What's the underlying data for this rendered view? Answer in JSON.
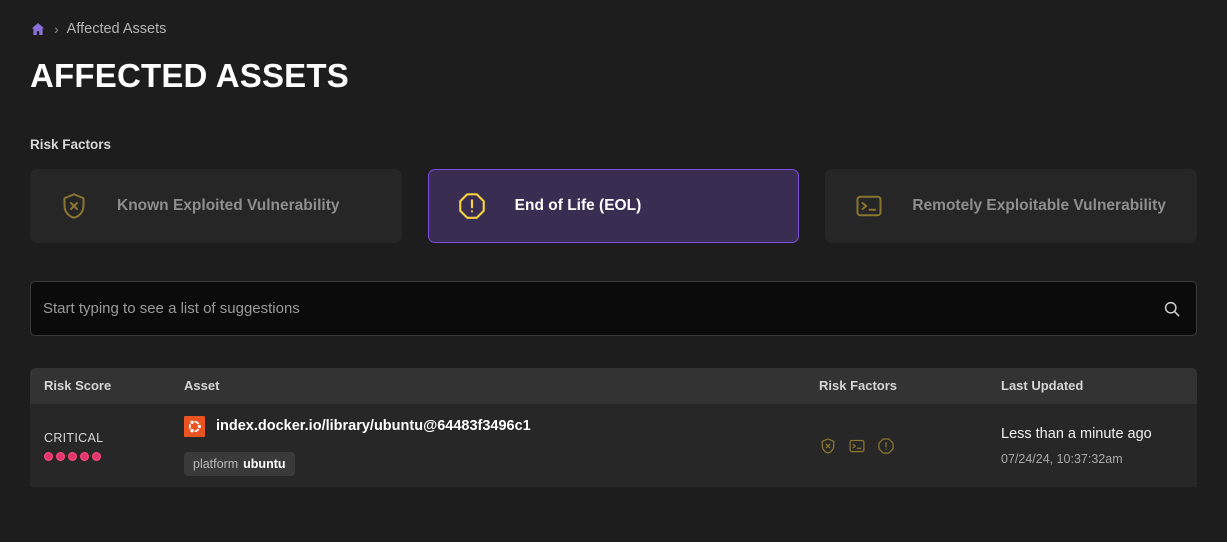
{
  "breadcrumb": {
    "home_icon": "home-icon",
    "separator": "›",
    "current": "Affected Assets"
  },
  "page_title": "AFFECTED ASSETS",
  "risk_factors_section": {
    "label": "Risk Factors",
    "cards": [
      {
        "label": "Known Exploited Vulnerability",
        "icon": "shield-x-icon",
        "selected": false
      },
      {
        "label": "End of Life (EOL)",
        "icon": "octagon-alert-icon",
        "selected": true
      },
      {
        "label": "Remotely Exploitable Vulnerability",
        "icon": "terminal-icon",
        "selected": false
      }
    ]
  },
  "search": {
    "placeholder": "Start typing to see a list of suggestions",
    "value": "",
    "icon": "search-icon"
  },
  "table": {
    "columns": [
      "Risk Score",
      "Asset",
      "Risk Factors",
      "Last Updated"
    ],
    "rows": [
      {
        "severity": "CRITICAL",
        "severity_dots": 5,
        "asset_icon": "ubuntu-logo",
        "asset_name": "index.docker.io/library/ubuntu@64483f3496c1",
        "tag_key": "platform",
        "tag_value": "ubuntu",
        "risk_factor_icons": [
          "shield-x-icon",
          "terminal-icon",
          "octagon-alert-icon"
        ],
        "updated_relative": "Less than a minute ago",
        "updated_absolute": "07/24/24, 10:37:32am"
      }
    ]
  },
  "colors": {
    "page_background": "#1d1d1d",
    "card_background": "#262626",
    "selected_card_background": "#3a2d52",
    "selected_card_border": "#7c4dde",
    "accent_purple": "#8b6fd8",
    "warning_yellow": "#f5d33f",
    "muted_gold": "#8a7530",
    "critical_pink": "#e0356b",
    "ubuntu_orange": "#e95420",
    "table_header_background": "#333333",
    "table_row_background": "#272727"
  }
}
